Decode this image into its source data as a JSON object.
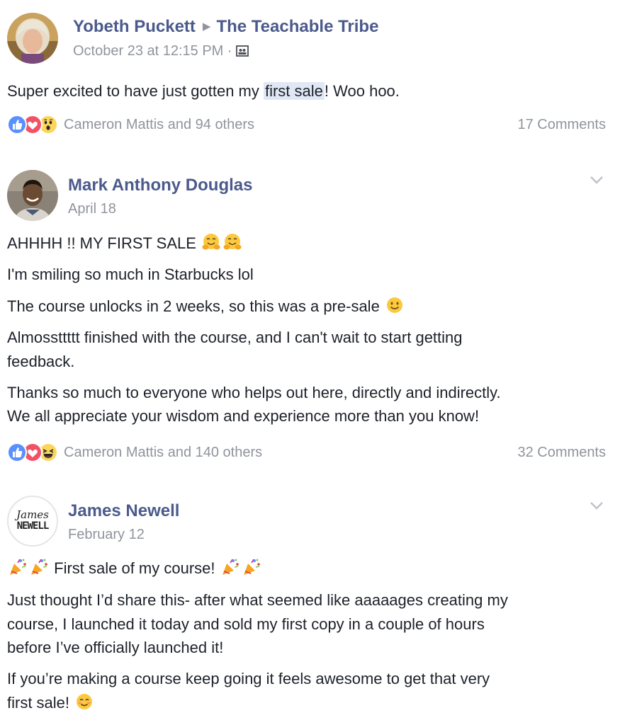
{
  "posts": [
    {
      "author": "Yobeth Puckett",
      "group": "The Teachable Tribe",
      "timestamp": "October 23 at 12:15 PM",
      "separator": "·",
      "privacy_icon": "group-icon",
      "text_before": "Super excited to have just gotten my ",
      "text_highlight": "first sale",
      "text_after": "! Woo hoo.",
      "reactions": [
        "like",
        "love",
        "wow"
      ],
      "reactors": "Cameron Mattis and 94 others",
      "comments": "17 Comments"
    },
    {
      "author": "Mark Anthony Douglas",
      "timestamp": "April 18",
      "lines": [
        "AHHHH !! MY FIRST SALE",
        "I'm smiling so much in Starbucks lol",
        "The course unlocks in 2 weeks, so this was a pre-sale",
        "Almossttttt finished with the course, and I can't wait to start getting",
        "feedback.",
        "Thanks so much to everyone who helps out here, directly and indirectly.",
        "We all appreciate your wisdom and experience more than you know!"
      ],
      "reactions": [
        "like",
        "love",
        "haha"
      ],
      "reactors": "Cameron Mattis and 140 others",
      "comments": "32 Comments"
    },
    {
      "author": "James Newell",
      "timestamp": "February 12",
      "avatar_logo_top": "James",
      "avatar_logo_bottom": "NEWELL",
      "lines": [
        "First sale of my course!",
        "Just thought I’d share this- after what seemed like aaaaages creating my",
        "course, I launched it today and sold my first copy in a couple of hours",
        "before I’ve officially launched it!",
        "If you’re making a course keep going it feels awesome to get that very",
        "first sale!"
      ]
    }
  ],
  "colors": {
    "name": "#4b5a8c",
    "meta": "#90949c",
    "text": "#1d2129",
    "highlight": "#e1e8f5",
    "like": "#5890ff",
    "love": "#f25268",
    "emoji_yellow": "#fcd55a"
  }
}
